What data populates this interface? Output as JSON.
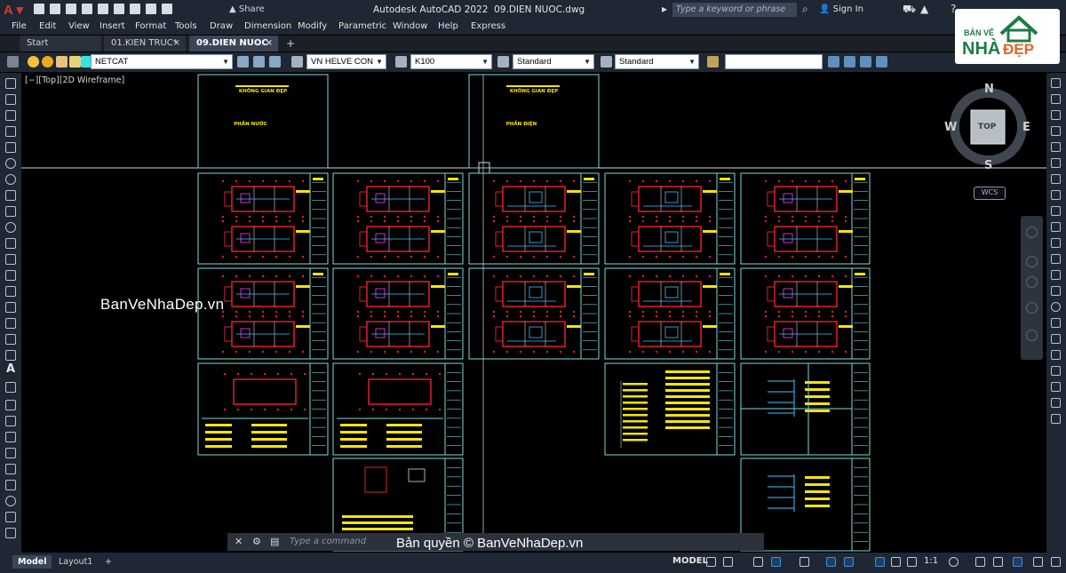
{
  "app": {
    "title": "Autodesk AutoCAD 2022",
    "filename": "09.DIEN NUOC.dwg",
    "share_label": "Share",
    "search_placeholder": "Type a keyword or phrase",
    "sign_in": "Sign In"
  },
  "menu": [
    "File",
    "Edit",
    "View",
    "Insert",
    "Format",
    "Tools",
    "Draw",
    "Dimension",
    "Modify",
    "Parametric",
    "Window",
    "Help",
    "Express"
  ],
  "tabs": {
    "start": "Start",
    "kien_truc": "01.KIEN TRUC*",
    "dien_nuoc": "09.DIEN NUOC",
    "close": "×",
    "add": "+"
  },
  "toolbar": {
    "layer": "NETCAT",
    "text_style": "VN HELVE CON",
    "dim_style": "K100",
    "table_style": "Standard",
    "mleader_style": "Standard"
  },
  "viewport": {
    "label": "[−][Top][2D Wireframe]",
    "sheet_titles": {
      "kgd": "KHÔNG GIAN ĐẸP",
      "water": "PHẦN NƯỚC",
      "electric": "PHẦN ĐIỆN"
    }
  },
  "viewcube": {
    "n": "N",
    "s": "S",
    "e": "E",
    "w": "W",
    "face": "TOP",
    "wcs": "WCS"
  },
  "command": {
    "placeholder": "Type a command"
  },
  "watermarks": {
    "middle": "BanVeNhaDep.vn",
    "bottom": "Bản quyền © BanVeNhaDep.vn",
    "logo_line1": "BẢN VẼ",
    "logo_line2": "NHÀ",
    "logo_line3": "ĐẸP"
  },
  "status": {
    "layout_tabs": [
      "Model",
      "Layout1",
      "+"
    ],
    "space": "MODEL",
    "annotation_scale": "1:1"
  },
  "colors": {
    "frame": "#7fd7d7",
    "red_walls": "#e0202a",
    "yellow_text": "#f5e600",
    "magenta": "#ff3cff",
    "cyan": "#39c6ff",
    "white_line": "#d8d8d8"
  }
}
